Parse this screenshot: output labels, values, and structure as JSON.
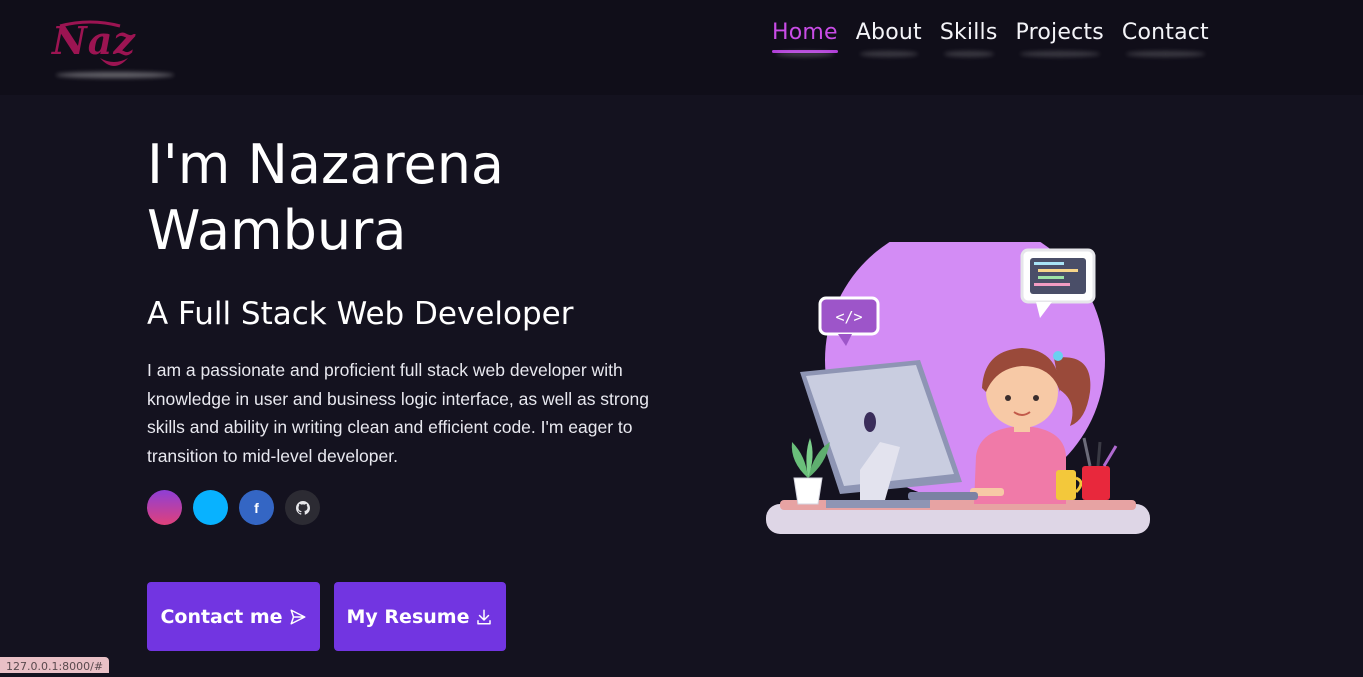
{
  "logo": {
    "text": "Naz",
    "color": "#9c1452"
  },
  "nav": {
    "items": [
      {
        "label": "Home",
        "active": true
      },
      {
        "label": "About",
        "active": false
      },
      {
        "label": "Skills",
        "active": false
      },
      {
        "label": "Projects",
        "active": false
      },
      {
        "label": "Contact",
        "active": false
      }
    ],
    "active_color": "#c94ce6"
  },
  "hero": {
    "title_line1": "I'm Nazarena",
    "title_line2": "Wambura",
    "subtitle": "A Full Stack Web Developer",
    "description": "I am a passionate and proficient full stack web developer with knowledge in user and business logic interface, as well as strong skills and ability in writing clean and efficient code. I'm eager to transition to mid-level developer."
  },
  "socials": [
    {
      "name": "instagram-icon",
      "glyph": ""
    },
    {
      "name": "twitter-icon",
      "glyph": ""
    },
    {
      "name": "facebook-icon",
      "glyph": "f"
    },
    {
      "name": "github-icon",
      "glyph": ""
    }
  ],
  "buttons": {
    "contact_label": "Contact me",
    "resume_label": "My Resume",
    "color": "#7235e1"
  },
  "illustration": {
    "code_bubble": "</>"
  },
  "status_bar": {
    "url": "127.0.0.1:8000/#"
  }
}
